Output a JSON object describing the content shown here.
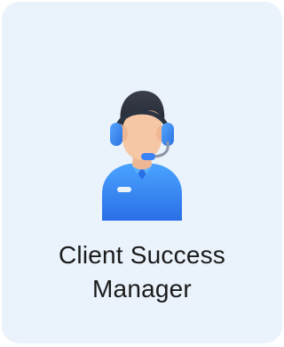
{
  "card": {
    "title_line1": "Client Success",
    "title_line2": "Manager",
    "icon": "customer-support-agent-headset-icon"
  },
  "colors": {
    "card_background": "#eaf2fb",
    "shirt": "#3b82f6",
    "headset": "#3b82f6",
    "hair": "#2b2f3a",
    "skin": "#f6c7a4"
  }
}
